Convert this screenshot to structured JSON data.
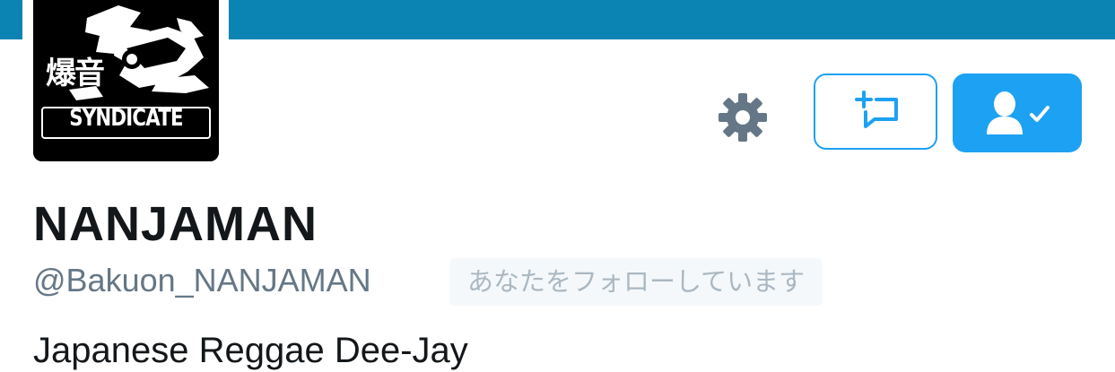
{
  "profile": {
    "display_name": "NANJAMAN",
    "handle": "@Bakuon_NANJAMAN",
    "follows_you_badge": "あなたをフォローしています",
    "bio": "Japanese Reggae Dee-Jay"
  },
  "avatar": {
    "kanji": "爆音",
    "wordmark": "SYNDICATE"
  },
  "actions": {
    "settings_icon": "gear-icon",
    "message_icon": "direct-message-icon",
    "following_icon": "person-check-icon"
  },
  "colors": {
    "header_banner": "#0b84b3",
    "accent": "#1da1f2",
    "gear": "#657786",
    "text_primary": "#14171a",
    "text_secondary": "#657786",
    "badge_bg": "#f5f8fa",
    "badge_text": "#aab8c2"
  }
}
